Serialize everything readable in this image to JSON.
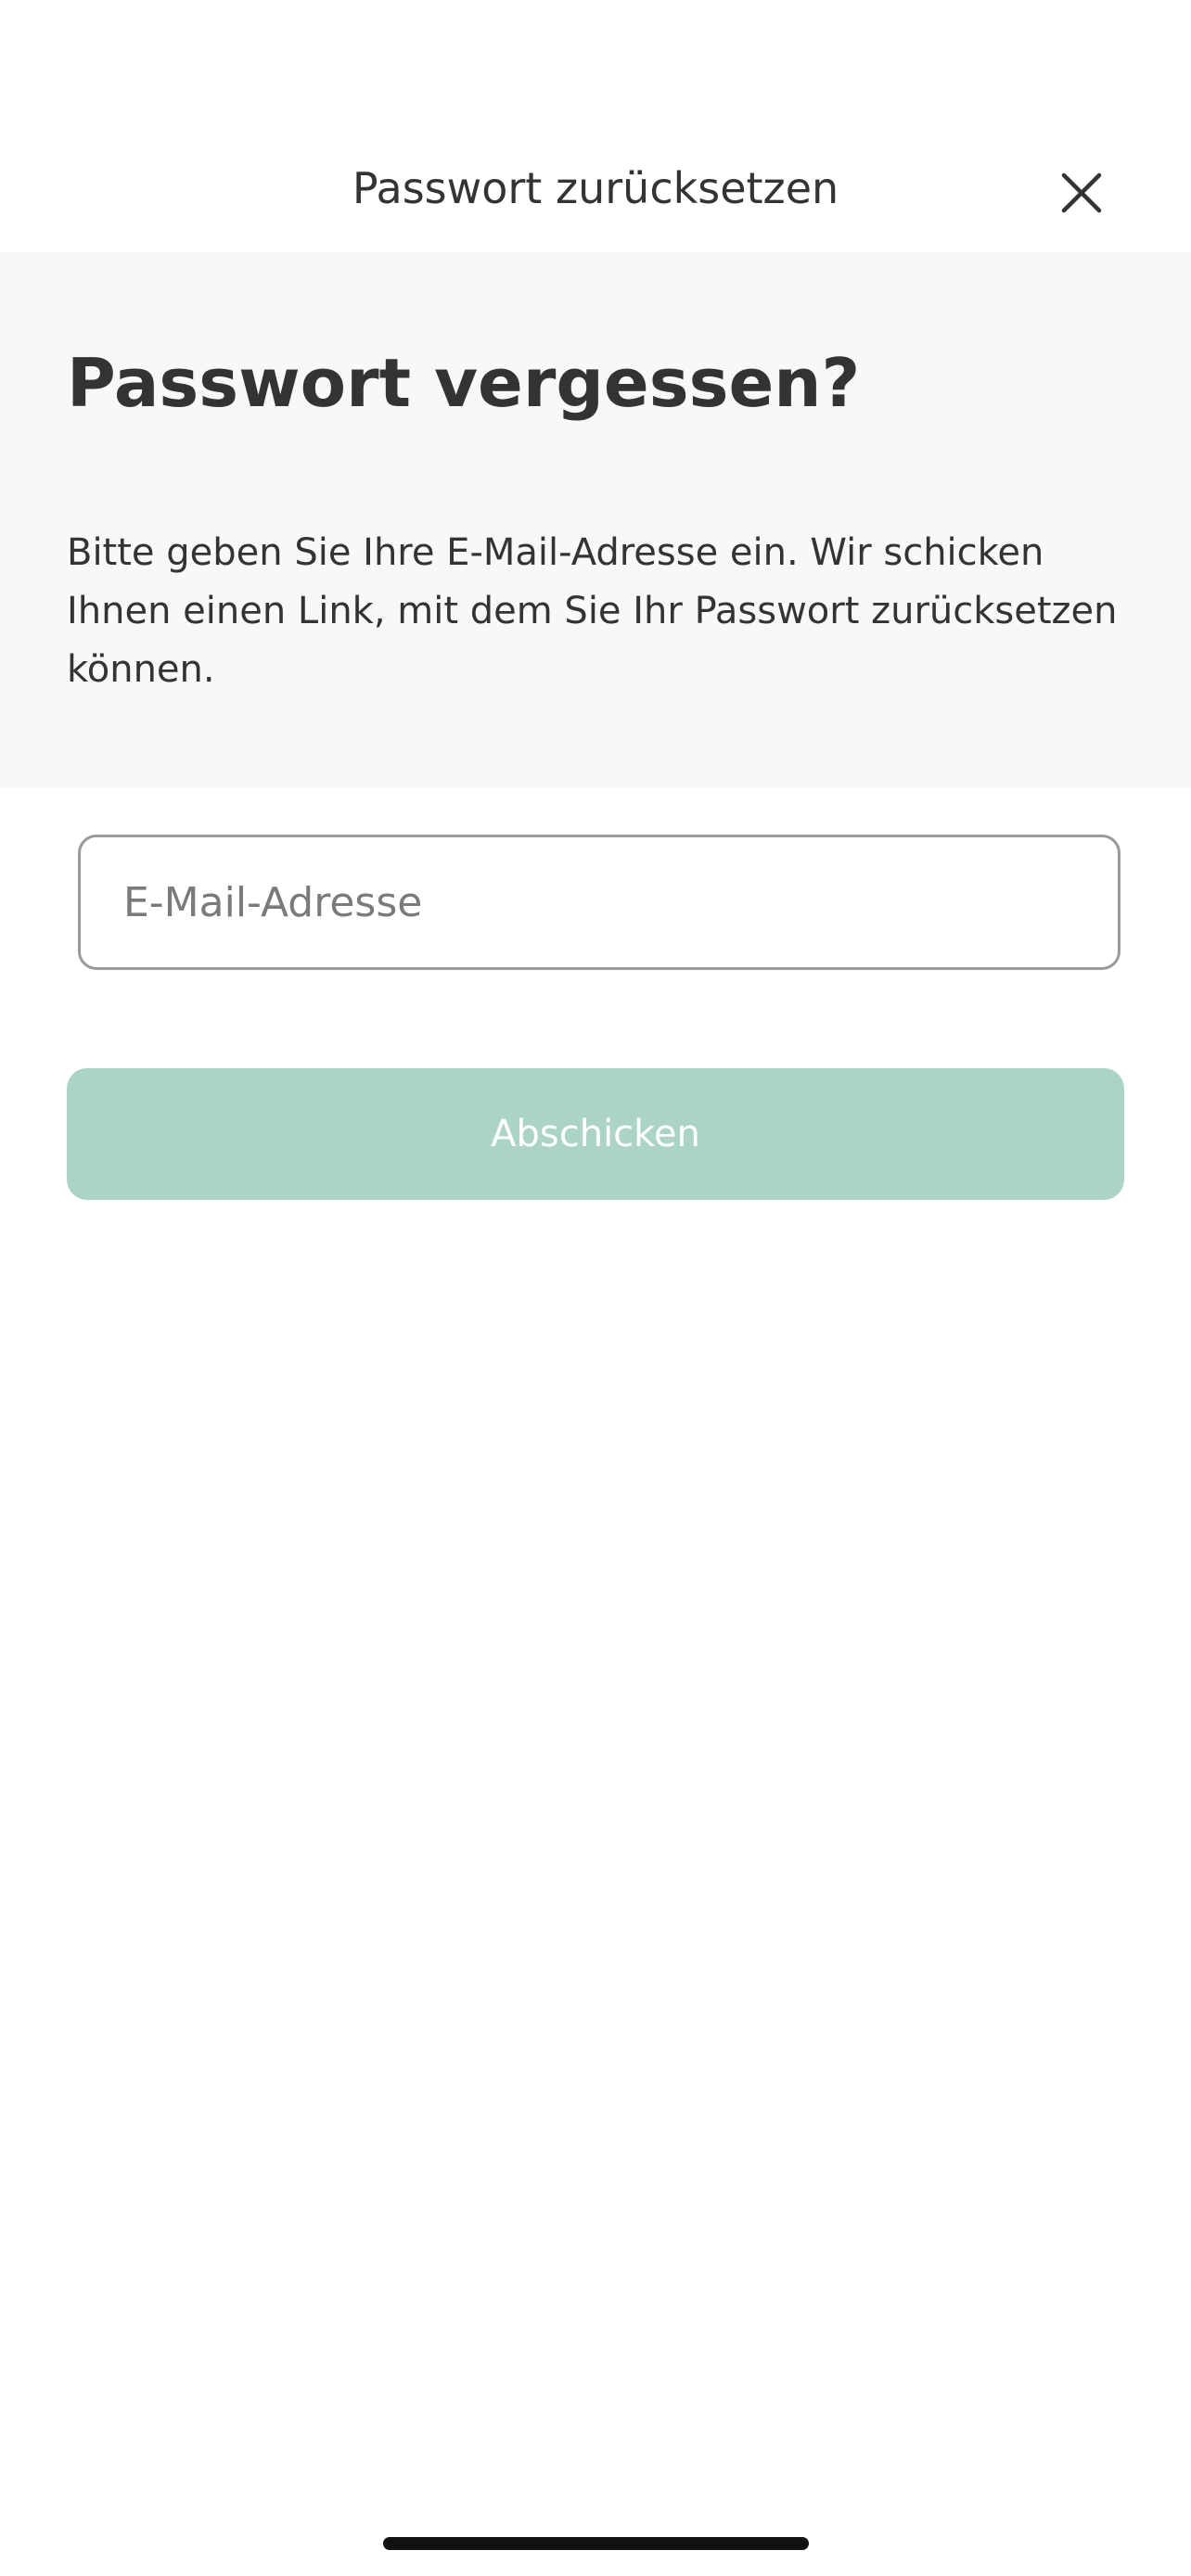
{
  "header": {
    "title": "Passwort zurücksetzen",
    "close_icon": "close-icon"
  },
  "intro": {
    "heading": "Passwort vergessen?",
    "text": "Bitte geben Sie Ihre E-Mail-Adresse ein. Wir schicken Ihnen einen Link, mit dem Sie Ihr Passwort zurücksetzen können."
  },
  "form": {
    "email_value": "",
    "email_placeholder": "E-Mail-Adresse",
    "submit_label": "Abschicken"
  },
  "colors": {
    "text": "#333333",
    "panel_background": "#f8f8f8",
    "submit_button": "#abd4c5",
    "field_border": "#9a9a9a"
  }
}
